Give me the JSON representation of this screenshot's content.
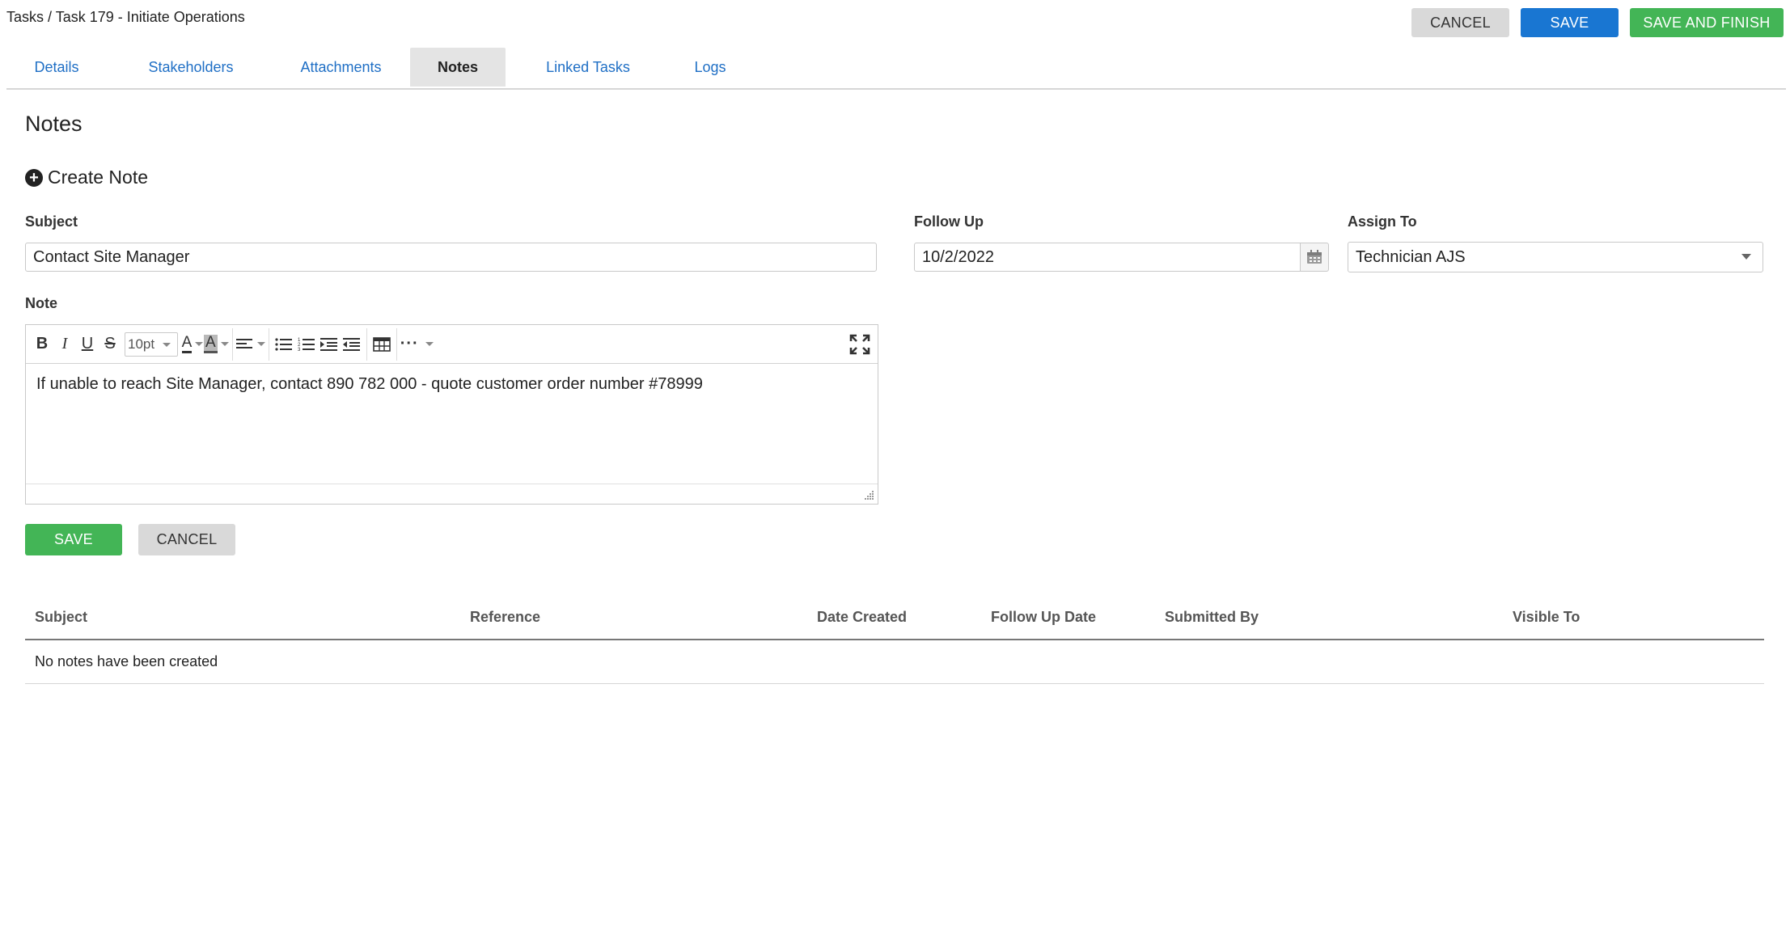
{
  "breadcrumb": "Tasks / Task 179 - Initiate Operations",
  "header_buttons": {
    "cancel": "CANCEL",
    "save": "SAVE",
    "save_finish": "SAVE AND FINISH"
  },
  "tabs": [
    {
      "label": "Details"
    },
    {
      "label": "Stakeholders"
    },
    {
      "label": "Attachments"
    },
    {
      "label": "Notes",
      "active": true
    },
    {
      "label": "Linked Tasks"
    },
    {
      "label": "Logs"
    }
  ],
  "section_title": "Notes",
  "create_note_label": "Create Note",
  "form": {
    "subject_label": "Subject",
    "subject_value": "Contact Site Manager",
    "follow_up_label": "Follow Up",
    "follow_up_value": "10/2/2022",
    "assign_to_label": "Assign To",
    "assign_to_value": "Technician AJS",
    "note_label": "Note",
    "font_size": "10pt",
    "note_text": "If unable to reach Site Manager, contact 890 782 000 - quote customer order number #78999",
    "save_label": "SAVE",
    "cancel_label": "CANCEL"
  },
  "table": {
    "columns": [
      "Subject",
      "Reference",
      "Date Created",
      "Follow Up Date",
      "Submitted By",
      "Visible To"
    ],
    "empty_message": "No notes have been created"
  },
  "colors": {
    "primary": "#1976d2",
    "success": "#43b556",
    "link": "#1f6fc5",
    "neutral_button": "#d9d9d9"
  }
}
